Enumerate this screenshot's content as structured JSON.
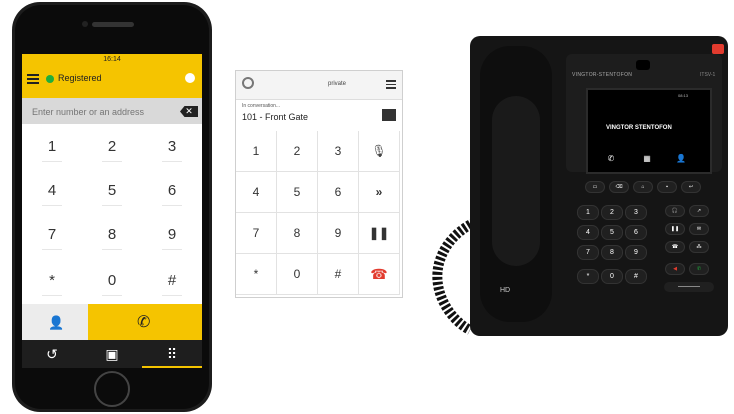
{
  "mobile": {
    "status_time": "16:14",
    "status_text": "Registered",
    "number_placeholder": "Enter number or an address",
    "keys": [
      "1",
      "2",
      "3",
      "4",
      "5",
      "6",
      "7",
      "8",
      "9",
      "*",
      "0",
      "#"
    ],
    "tabs": [
      "recents-icon",
      "contacts-icon",
      "keypad-icon"
    ]
  },
  "tablet": {
    "header_label": "private",
    "conversation_label": "In conversation...",
    "conversation_line": "101 - Front Gate",
    "keys": [
      "1",
      "2",
      "3",
      "4",
      "5",
      "6",
      "7",
      "8",
      "9",
      "*",
      "0",
      "#"
    ]
  },
  "deskphone": {
    "brand": "VINGTOR-STENTOFON",
    "model": "ITSV-1",
    "screen_logo": "VINGTOR STENTOFON",
    "screen_status": "08:13",
    "hd_label": "HD",
    "keypad": [
      "1",
      "2",
      "3",
      "4",
      "5",
      "6",
      "7",
      "8",
      "9",
      "*",
      "0",
      "#"
    ]
  },
  "colors": {
    "accent": "#f5c400",
    "registered": "#1fae3c",
    "hangup": "#e23b2e"
  }
}
